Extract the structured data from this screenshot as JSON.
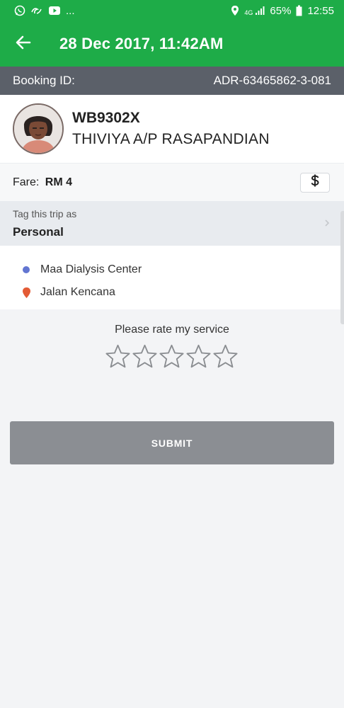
{
  "status_bar": {
    "battery": "65%",
    "time": "12:55",
    "network": "4G",
    "more": "..."
  },
  "app_bar": {
    "title": "28 Dec 2017, 11:42AM",
    "back_icon": "arrow-left-icon"
  },
  "booking": {
    "label": "Booking ID:",
    "id": "ADR-63465862-3-081"
  },
  "driver": {
    "plate": "WB9302X",
    "name": "THIVIYA A/P RASAPANDIAN"
  },
  "fare": {
    "label": "Fare:",
    "value": "RM 4",
    "payment_icon": "dollar-icon"
  },
  "tag": {
    "label": "Tag this trip as",
    "value": "Personal"
  },
  "route": {
    "pickup": "Maa Dialysis Center",
    "dropoff": "Jalan Kencana"
  },
  "rating": {
    "prompt": "Please rate my service",
    "stars_total": 5,
    "stars_selected": 0
  },
  "submit_label": "SUBMIT",
  "colors": {
    "brand_green": "#1eac48",
    "booking_bar": "#5b6069",
    "pickup_dot": "#6275d1",
    "dropoff_pin": "#e35b35",
    "submit_disabled": "#8b8e93"
  }
}
